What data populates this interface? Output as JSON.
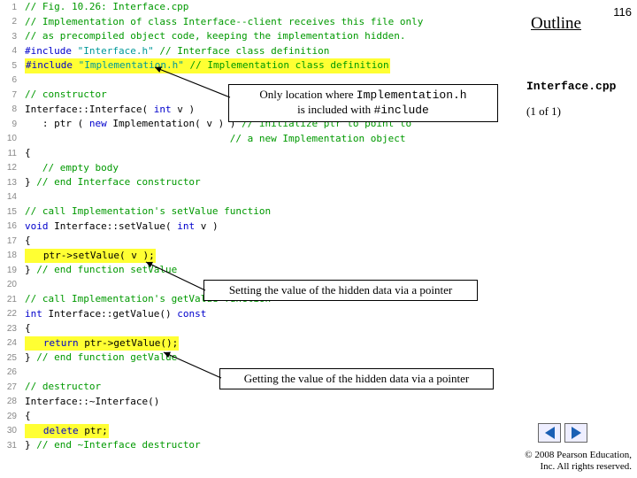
{
  "header": {
    "outline": "Outline",
    "page_number": "116",
    "filename": "Interface.cpp",
    "pager": "(1 of 1)"
  },
  "callouts": {
    "c1_a": "Only location where ",
    "c1_b": "Implementation.h",
    "c1_c": " is included with ",
    "c1_d": "#include",
    "c2": "Setting the value of the hidden data via a pointer",
    "c3": "Getting the value of the hidden data via a pointer"
  },
  "code": [
    {
      "n": "1",
      "frags": [
        {
          "cls": "c-comment",
          "t": "// Fig. 10.26: Interface.cpp"
        }
      ]
    },
    {
      "n": "2",
      "frags": [
        {
          "cls": "c-comment",
          "t": "// Implementation of class Interface--client receives this file only"
        }
      ]
    },
    {
      "n": "3",
      "frags": [
        {
          "cls": "c-comment",
          "t": "// as precompiled object code, keeping the implementation hidden."
        }
      ]
    },
    {
      "n": "4",
      "frags": [
        {
          "cls": "c-keyword",
          "t": "#include "
        },
        {
          "cls": "c-string",
          "t": "\"Interface.h\""
        },
        {
          "cls": "c-ident",
          "t": " "
        },
        {
          "cls": "c-comment",
          "t": "// Interface class definition"
        }
      ]
    },
    {
      "n": "5",
      "hl": true,
      "frags": [
        {
          "cls": "c-keyword",
          "t": "#include "
        },
        {
          "cls": "c-string",
          "t": "\"Implementation.h\""
        },
        {
          "cls": "c-ident",
          "t": " "
        },
        {
          "cls": "c-comment",
          "t": "// Implementation class definition"
        }
      ]
    },
    {
      "n": "6",
      "frags": []
    },
    {
      "n": "7",
      "frags": [
        {
          "cls": "c-comment",
          "t": "// constructor"
        }
      ]
    },
    {
      "n": "8",
      "frags": [
        {
          "cls": "c-ident",
          "t": "Interface::Interface( "
        },
        {
          "cls": "c-keyword",
          "t": "int"
        },
        {
          "cls": "c-ident",
          "t": " v )"
        }
      ]
    },
    {
      "n": "9",
      "frags": [
        {
          "cls": "c-ident",
          "t": "   : ptr ( "
        },
        {
          "cls": "c-keyword",
          "t": "new"
        },
        {
          "cls": "c-ident",
          "t": " Implementation( v ) ) "
        },
        {
          "cls": "c-comment",
          "t": "// initialize ptr to point to"
        }
      ]
    },
    {
      "n": "10",
      "frags": [
        {
          "cls": "c-ident",
          "t": "                                   "
        },
        {
          "cls": "c-comment",
          "t": "// a new Implementation object"
        }
      ]
    },
    {
      "n": "11",
      "frags": [
        {
          "cls": "c-ident",
          "t": "{"
        }
      ]
    },
    {
      "n": "12",
      "frags": [
        {
          "cls": "c-ident",
          "t": "   "
        },
        {
          "cls": "c-comment",
          "t": "// empty body"
        }
      ]
    },
    {
      "n": "13",
      "frags": [
        {
          "cls": "c-ident",
          "t": "} "
        },
        {
          "cls": "c-comment",
          "t": "// end Interface constructor"
        }
      ]
    },
    {
      "n": "14",
      "frags": []
    },
    {
      "n": "15",
      "frags": [
        {
          "cls": "c-comment",
          "t": "// call Implementation's setValue function"
        }
      ]
    },
    {
      "n": "16",
      "frags": [
        {
          "cls": "c-keyword",
          "t": "void"
        },
        {
          "cls": "c-ident",
          "t": " Interface::setValue( "
        },
        {
          "cls": "c-keyword",
          "t": "int"
        },
        {
          "cls": "c-ident",
          "t": " v )"
        }
      ]
    },
    {
      "n": "17",
      "frags": [
        {
          "cls": "c-ident",
          "t": "{"
        }
      ]
    },
    {
      "n": "18",
      "hl": true,
      "frags": [
        {
          "cls": "c-ident",
          "t": "   ptr->setValue( v );"
        }
      ]
    },
    {
      "n": "19",
      "frags": [
        {
          "cls": "c-ident",
          "t": "} "
        },
        {
          "cls": "c-comment",
          "t": "// end function setValue"
        }
      ]
    },
    {
      "n": "20",
      "frags": []
    },
    {
      "n": "21",
      "frags": [
        {
          "cls": "c-comment",
          "t": "// call Implementation's getValue function"
        }
      ]
    },
    {
      "n": "22",
      "frags": [
        {
          "cls": "c-keyword",
          "t": "int"
        },
        {
          "cls": "c-ident",
          "t": " Interface::getValue() "
        },
        {
          "cls": "c-keyword",
          "t": "const"
        }
      ]
    },
    {
      "n": "23",
      "frags": [
        {
          "cls": "c-ident",
          "t": "{"
        }
      ]
    },
    {
      "n": "24",
      "hl": true,
      "frags": [
        {
          "cls": "c-ident",
          "t": "   "
        },
        {
          "cls": "c-keyword",
          "t": "return"
        },
        {
          "cls": "c-ident",
          "t": " ptr->getValue();"
        }
      ]
    },
    {
      "n": "25",
      "frags": [
        {
          "cls": "c-ident",
          "t": "} "
        },
        {
          "cls": "c-comment",
          "t": "// end function getValue"
        }
      ]
    },
    {
      "n": "26",
      "frags": []
    },
    {
      "n": "27",
      "frags": [
        {
          "cls": "c-comment",
          "t": "// destructor"
        }
      ]
    },
    {
      "n": "28",
      "frags": [
        {
          "cls": "c-ident",
          "t": "Interface::~Interface()"
        }
      ]
    },
    {
      "n": "29",
      "frags": [
        {
          "cls": "c-ident",
          "t": "{"
        }
      ]
    },
    {
      "n": "30",
      "hl": true,
      "frags": [
        {
          "cls": "c-ident",
          "t": "   "
        },
        {
          "cls": "c-keyword",
          "t": "delete"
        },
        {
          "cls": "c-ident",
          "t": " ptr;"
        }
      ]
    },
    {
      "n": "31",
      "frags": [
        {
          "cls": "c-ident",
          "t": "} "
        },
        {
          "cls": "c-comment",
          "t": "// end ~Interface destructor"
        }
      ]
    }
  ],
  "footer": {
    "copyright_1": "© 2008 Pearson Education,",
    "copyright_2": "Inc.  All rights reserved."
  }
}
